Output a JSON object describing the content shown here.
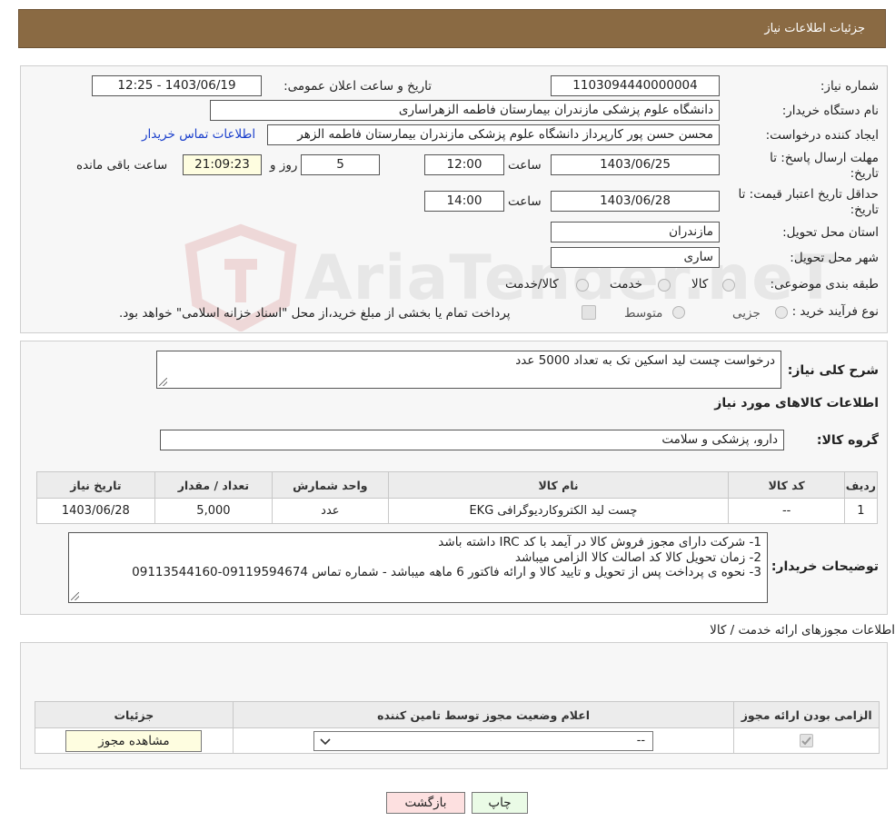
{
  "header": {
    "title": "جزئیات اطلاعات نیاز"
  },
  "need": {
    "number_label": "شماره نیاز:",
    "number_value": "1103094440000004",
    "announce_label": "تاریخ و ساعت اعلان عمومی:",
    "announce_value": "1403/06/19 - 12:25",
    "buyer_org_label": "نام دستگاه خریدار:",
    "buyer_org_value": "دانشگاه علوم پزشکی مازندران بیمارستان فاطمه الزهراساری",
    "creator_label": "ایجاد کننده درخواست:",
    "creator_value": "محسن حسن پور کارپرداز دانشگاه علوم پزشکی مازندران بیمارستان فاطمه الزهر",
    "contact_link": "اطلاعات تماس خریدار",
    "deadline_label_1": "مهلت ارسال پاسخ: تا",
    "deadline_label_2": "تاریخ:",
    "deadline_date": "1403/06/25",
    "deadline_time_label": "ساعت",
    "deadline_time": "12:00",
    "days_value": "5",
    "days_label": "روز و",
    "remaining_time": "21:09:23",
    "remaining_label": "ساعت باقی مانده",
    "validity_label_1": "حداقل تاریخ اعتبار قیمت: تا",
    "validity_label_2": "تاریخ:",
    "validity_date": "1403/06/28",
    "validity_time_label": "ساعت",
    "validity_time": "14:00",
    "province_label": "استان محل تحویل:",
    "province_value": "مازندران",
    "city_label": "شهر محل تحویل:",
    "city_value": "ساری",
    "category_label": "طبقه بندی موضوعی:",
    "category_options": [
      "کالا",
      "خدمت",
      "کالا/خدمت"
    ],
    "process_label": "نوع فرآیند خرید :",
    "process_options": [
      "جزیی",
      "متوسط"
    ],
    "process_note": "پرداخت تمام یا بخشی از مبلغ خرید،از محل \"اسناد خزانه اسلامی\" خواهد بود."
  },
  "description": {
    "label": "شرح کلی نیاز:",
    "value": "درخواست چست لید اسکین تک به تعداد 5000 عدد",
    "goods_title": "اطلاعات کالاهای مورد نیاز",
    "group_label": "گروه کالا:",
    "group_value": "دارو، پزشکی و سلامت"
  },
  "goods_table": {
    "headers": [
      "ردیف",
      "کد کالا",
      "نام کالا",
      "واحد شمارش",
      "تعداد / مقدار",
      "تاریخ نیاز"
    ],
    "rows": [
      [
        "1",
        "--",
        "چست لید الکتروکاردیوگرافی EKG",
        "عدد",
        "5,000",
        "1403/06/28"
      ]
    ]
  },
  "buyer_notes": {
    "label": "توضیحات خریدار:",
    "lines": [
      "1- شرکت دارای مجوز فروش کالا در آیمد با کد IRC داشته باشد",
      "2- زمان تحویل کالا کد اصالت کالا الزامی میباشد",
      "3- نحوه ی پرداخت پس از تحویل و تایید کالا و ارائه فاکتور 6 ماهه میباشد - شماره تماس 09119594674-09113544160"
    ]
  },
  "licenses": {
    "title": "اطلاعات مجوزهای ارائه خدمت / کالا",
    "headers": [
      "الزامی بودن ارائه مجوز",
      "اعلام وضعیت مجوز توسط تامین کننده",
      "جزئیات"
    ],
    "select_value": "--",
    "view_button": "مشاهده مجوز"
  },
  "footer": {
    "print_button": "چاپ",
    "back_button": "بازگشت"
  },
  "watermark": {
    "text": "AriaTender.neT"
  },
  "colors": {
    "header_bg": "#8a6a43",
    "link": "#1a3fcc",
    "back_button_bg": "#fde0e0",
    "print_button_bg": "#eafbe6",
    "remaining_bg": "#fefde0"
  }
}
